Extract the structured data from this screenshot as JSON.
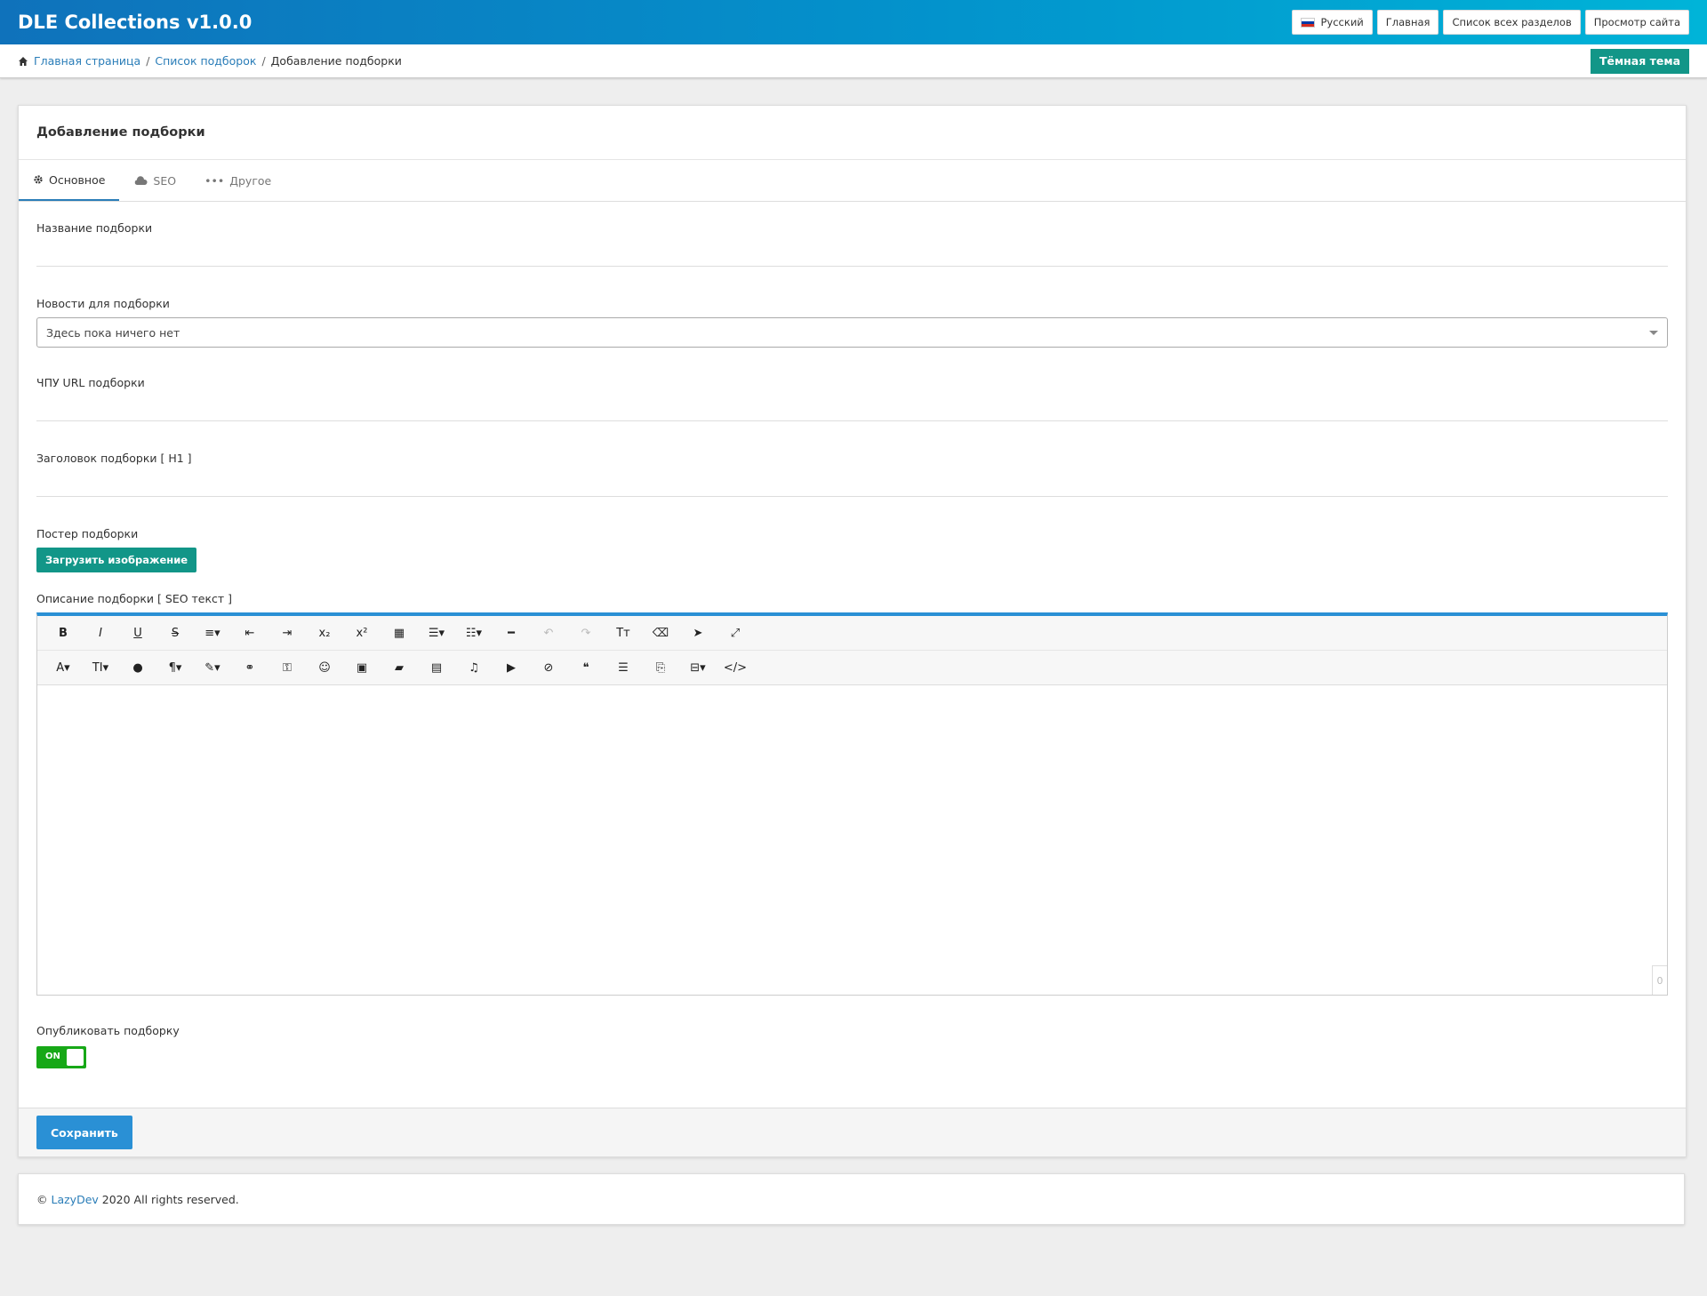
{
  "header": {
    "brand": "DLE Collections v1.0.0",
    "language": "Русский",
    "home": "Главная",
    "sections": "Список всех разделов",
    "view_site": "Просмотр сайта"
  },
  "breadcrumb": {
    "home": "Главная страница",
    "list": "Список подборок",
    "current": "Добавление подборки"
  },
  "theme_button": "Тёмная тема",
  "page": {
    "title": "Добавление подборки",
    "tabs": [
      {
        "label": "Основное",
        "icon": "gear-icon"
      },
      {
        "label": "SEO",
        "icon": "cloud-icon"
      },
      {
        "label": "Другое",
        "icon": "dots-icon"
      }
    ]
  },
  "form": {
    "name_label": "Название подборки",
    "news_label": "Новости для подборки",
    "news_placeholder": "Здесь пока ничего нет",
    "url_label": "ЧПУ URL подборки",
    "h1_label": "Заголовок подборки [ H1 ]",
    "poster_label": "Постер подборки",
    "upload_button": "Загрузить изображение",
    "description_label": "Описание подборки [ SEO текст ]",
    "char_count": "0",
    "publish_label": "Опубликовать подборку",
    "publish_state": "ON",
    "save_button": "Сохранить"
  },
  "toolbar": {
    "row1": [
      {
        "name": "bold-button",
        "glyph": "B"
      },
      {
        "name": "italic-button",
        "glyph": "I"
      },
      {
        "name": "underline-button",
        "glyph": "U"
      },
      {
        "name": "strikethrough-button",
        "glyph": "S"
      },
      {
        "name": "align-dropdown",
        "glyph": "≡▾"
      },
      {
        "name": "outdent-button",
        "glyph": "⇤"
      },
      {
        "name": "indent-button",
        "glyph": "⇥"
      },
      {
        "name": "subscript-button",
        "glyph": "x₂"
      },
      {
        "name": "superscript-button",
        "glyph": "x²"
      },
      {
        "name": "table-button",
        "glyph": "▦"
      },
      {
        "name": "ordered-list-dropdown",
        "glyph": "☰▾"
      },
      {
        "name": "unordered-list-dropdown",
        "glyph": "☷▾"
      },
      {
        "name": "horizontal-line-button",
        "glyph": "━"
      },
      {
        "name": "undo-button",
        "glyph": "↶",
        "disabled": true
      },
      {
        "name": "redo-button",
        "glyph": "↷",
        "disabled": true
      },
      {
        "name": "clear-format-button",
        "glyph": "Tт"
      },
      {
        "name": "eraser-button",
        "glyph": "⌫"
      },
      {
        "name": "select-button",
        "glyph": "➤"
      },
      {
        "name": "fullscreen-button",
        "glyph": "⤢"
      }
    ],
    "row2": [
      {
        "name": "font-dropdown",
        "glyph": "A▾"
      },
      {
        "name": "font-size-dropdown",
        "glyph": "TI▾"
      },
      {
        "name": "color-button",
        "glyph": "●"
      },
      {
        "name": "paragraph-dropdown",
        "glyph": "¶▾"
      },
      {
        "name": "magic-dropdown",
        "glyph": "✎▾"
      },
      {
        "name": "link-button",
        "glyph": "⚭"
      },
      {
        "name": "key-button",
        "glyph": "⚿"
      },
      {
        "name": "emoji-button",
        "glyph": "☺"
      },
      {
        "name": "image-button",
        "glyph": "▣"
      },
      {
        "name": "folder-button",
        "glyph": "▰"
      },
      {
        "name": "media-button",
        "glyph": "▤"
      },
      {
        "name": "audio-button",
        "glyph": "♫"
      },
      {
        "name": "video-button",
        "glyph": "▶"
      },
      {
        "name": "hide-button",
        "glyph": "⊘"
      },
      {
        "name": "quote-button",
        "glyph": "❝"
      },
      {
        "name": "align-text-button",
        "glyph": "☰"
      },
      {
        "name": "page-break-button",
        "glyph": "⎘"
      },
      {
        "name": "code-block-dropdown",
        "glyph": "⊟▾"
      },
      {
        "name": "code-view-button",
        "glyph": "</>"
      }
    ]
  },
  "footer": {
    "copyright_prefix": "©",
    "company": "LazyDev",
    "rest": "2020 All rights reserved."
  },
  "colors": {
    "accent": "#2a90d5",
    "teal": "#129688",
    "switch_on": "#17a817",
    "header_start": "#0f72bb",
    "header_end": "#00b4d8"
  }
}
